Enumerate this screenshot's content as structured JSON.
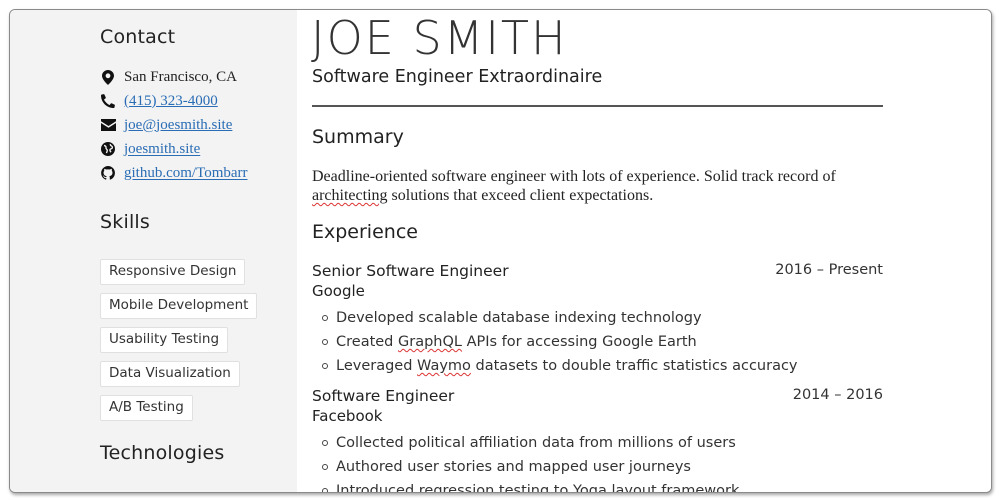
{
  "sidebar": {
    "contact_heading": "Contact",
    "contact": [
      {
        "icon": "map-marker-icon",
        "text": "San Francisco, CA",
        "link": false
      },
      {
        "icon": "phone-icon",
        "text": "(415) 323-4000",
        "link": true
      },
      {
        "icon": "envelope-icon",
        "text": "joe@joesmith.site",
        "link": true
      },
      {
        "icon": "globe-icon",
        "text": "joesmith.site",
        "link": true
      },
      {
        "icon": "github-icon",
        "text": "github.com/Tombarr",
        "link": true
      }
    ],
    "skills_heading": "Skills",
    "skills": [
      "Responsive Design",
      "Mobile Development",
      "Usability Testing",
      "Data Visualization",
      "A/B Testing"
    ],
    "technologies_heading": "Technologies"
  },
  "header": {
    "name": "JOE SMITH",
    "title": "Software Engineer Extraordinaire"
  },
  "summary": {
    "heading": "Summary",
    "text_part1": "Deadline-oriented software engineer with lots of experience. Solid track record of ",
    "misspelled": "architecting",
    "text_part2": " solutions that exceed client expectations."
  },
  "experience": {
    "heading": "Experience",
    "jobs": [
      {
        "title": "Senior Software Engineer",
        "company": "Google",
        "dates": "2016 – Present",
        "bullets": [
          "Developed scalable database indexing technology",
          "Created GraphQL APIs for accessing Google Earth",
          "Leveraged Waymo datasets to double traffic statistics accuracy"
        ]
      },
      {
        "title": "Software Engineer",
        "company": "Facebook",
        "dates": "2014 – 2016",
        "bullets": [
          "Collected political affiliation data from millions of users",
          "Authored user stories and mapped user journeys",
          "Introduced regression testing to Yoga layout framework"
        ]
      }
    ]
  },
  "colors": {
    "link": "#2a6db5",
    "sidebar_bg": "#f3f3f3",
    "spellcheck": "#dd3333"
  }
}
